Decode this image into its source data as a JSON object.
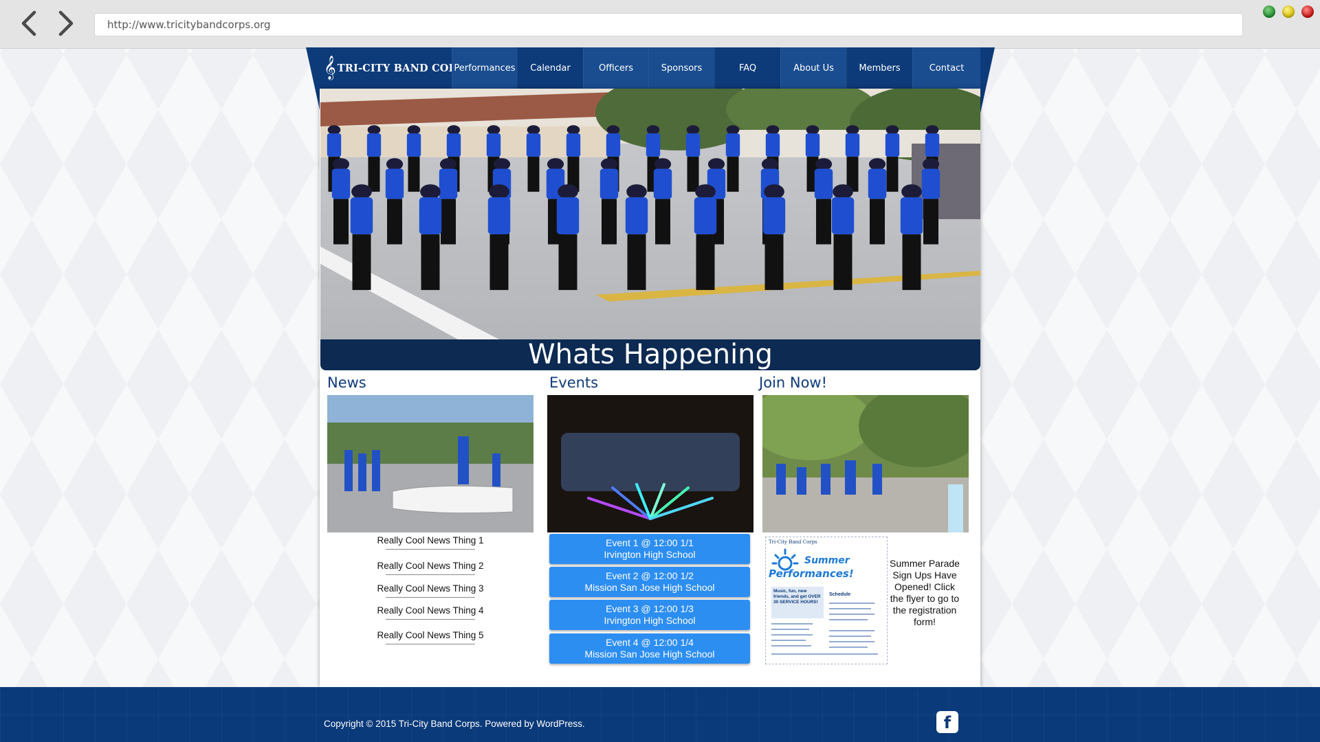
{
  "browser": {
    "url": "http://www.tricitybandcorps.org"
  },
  "site": {
    "logo_text": "TRI-CITY BAND CORPS",
    "logo_clef": "𝄞",
    "nav": [
      {
        "label": "Performances"
      },
      {
        "label": "Calendar"
      },
      {
        "label": "Officers"
      },
      {
        "label": "Sponsors"
      },
      {
        "label": "FAQ"
      },
      {
        "label": "About Us"
      },
      {
        "label": "Members"
      },
      {
        "label": "Contact"
      }
    ],
    "colors": {
      "navy": "#0d3b7a",
      "nav_alt": "#1a4d8f",
      "event_blue": "#2d8ef2",
      "banner": "#0c2a52"
    }
  },
  "main": {
    "banner_title": "Whats Happening",
    "columns": {
      "news": {
        "title": "News",
        "items": [
          "Really Cool News Thing 1",
          "Really Cool News Thing 2",
          "Really Cool News Thing 3",
          "Really Cool News Thing 4",
          "Really Cool News Thing 5"
        ]
      },
      "events": {
        "title": "Events",
        "items": [
          {
            "line1": "Event 1 @ 12:00 1/1",
            "line2": "Irvington High School"
          },
          {
            "line1": "Event 2 @ 12:00 1/2",
            "line2": "Mission San Jose High School"
          },
          {
            "line1": "Event 3 @ 12:00 1/3",
            "line2": "Irvington High School"
          },
          {
            "line1": "Event 4 @ 12:00 1/4",
            "line2": "Mission San Jose High School"
          }
        ]
      },
      "join": {
        "title": "Join Now!",
        "flyer": {
          "org": "Tri-City Band Corps",
          "headline_1": "Summer",
          "headline_2": "Performances!",
          "blurb": "Music, fun, new friends, and get OVER 30 SERVICE HOURS!",
          "schedule_label": "Schedule"
        },
        "note": "Summer Parade Sign Ups Have Opened! Click the flyer to go to the registration form!"
      }
    }
  },
  "footer": {
    "copyright": "Copyright © 2015 Tri-City Band Corps. Powered by WordPress.",
    "facebook_glyph": "f"
  }
}
